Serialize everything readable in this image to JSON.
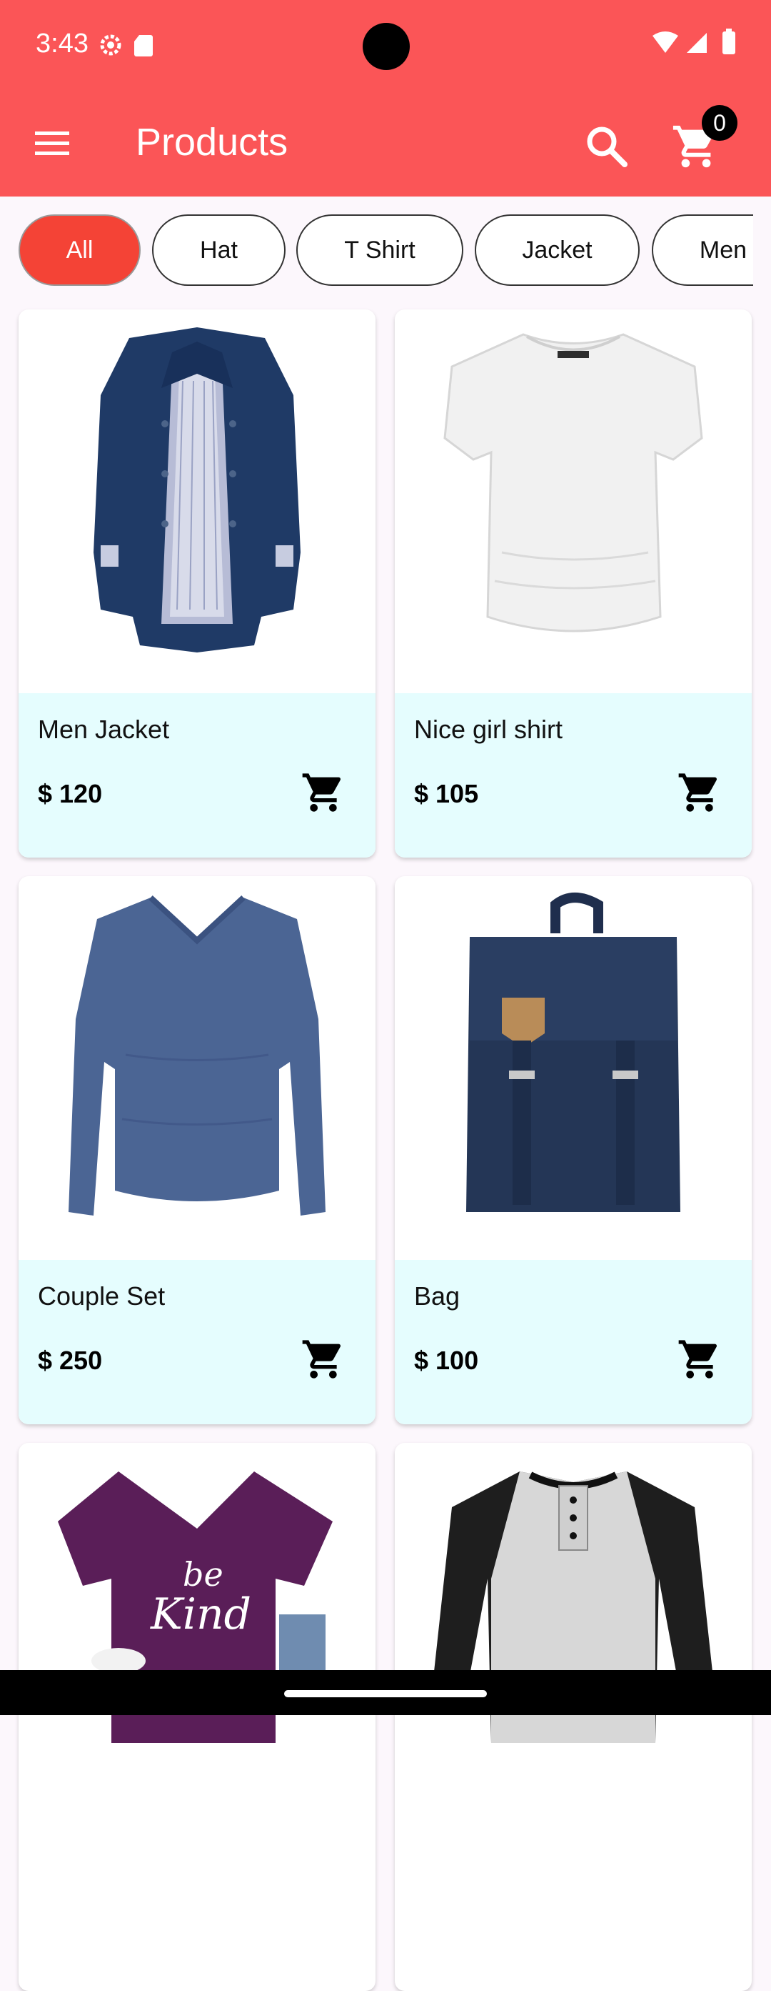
{
  "status_bar": {
    "time": "3:43"
  },
  "app_bar": {
    "title": "Products",
    "cart_count": "0"
  },
  "colors": {
    "primary": "#FB5557",
    "chip_active": "#F44336",
    "card_info_bg": "#E5FDFE"
  },
  "categories": [
    "All",
    "Hat",
    "T Shirt",
    "Jacket",
    "Men"
  ],
  "selected_category": "All",
  "products": [
    {
      "name": "Men Jacket",
      "price": "$ 120",
      "image": "navy-jacket"
    },
    {
      "name": "Nice girl shirt",
      "price": "$ 105",
      "image": "white-top"
    },
    {
      "name": "Couple Set",
      "price": "$ 250",
      "image": "blue-long-sleeve"
    },
    {
      "name": "Bag",
      "price": "$ 100",
      "image": "navy-backpack"
    },
    {
      "name": "",
      "price": "",
      "image": "purple-be-kind-tee"
    },
    {
      "name": "",
      "price": "",
      "image": "grey-raglan-henley"
    }
  ]
}
